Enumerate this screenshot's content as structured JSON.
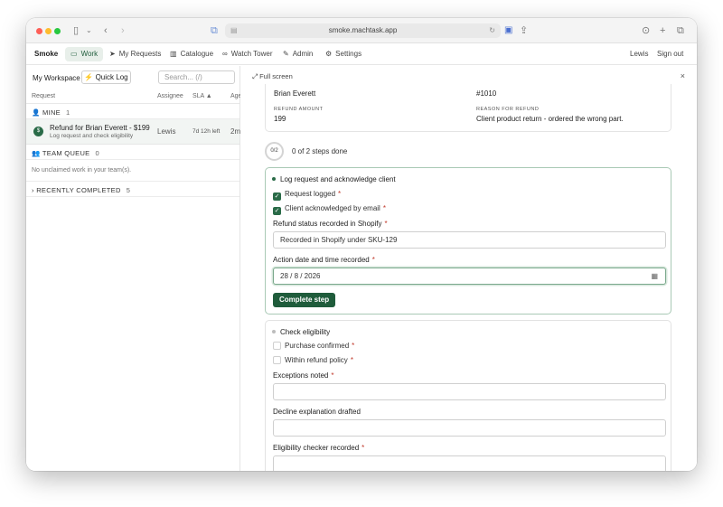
{
  "browser": {
    "url": "smoke.machtask.app"
  },
  "nav": {
    "brand": "Smoke",
    "items": [
      {
        "label": "Work",
        "icon": "inbox-icon",
        "active": true
      },
      {
        "label": "My Requests",
        "icon": "send-icon"
      },
      {
        "label": "Catalogue",
        "icon": "catalogue-icon"
      },
      {
        "label": "Watch Tower",
        "icon": "binoculars-icon"
      },
      {
        "label": "Admin",
        "icon": "wrench-icon"
      },
      {
        "label": "Settings",
        "icon": "gear-icon"
      }
    ],
    "user": "Lewis",
    "sign_out": "Sign out"
  },
  "left": {
    "workspace": "My Workspace",
    "quick_log": "Quick Log",
    "search_placeholder": "Search... (/)",
    "columns": {
      "request": "Request",
      "assignee": "Assignee",
      "sla": "SLA ▲",
      "age": "Age"
    },
    "mine": {
      "label": "MINE",
      "count": "1"
    },
    "row": {
      "title": "Refund for Brian Everett - $199",
      "subtitle": "Log request and check eligibility",
      "assignee": "Lewis",
      "sla": "7d 12h left",
      "age": "2m"
    },
    "team_queue": {
      "label": "TEAM QUEUE",
      "count": "0"
    },
    "empty_text": "No unclaimed work in your team(s).",
    "recently_completed": {
      "label": "RECENTLY COMPLETED",
      "count": "5"
    }
  },
  "right": {
    "full_screen": "Full screen",
    "summary": {
      "client_value": "Brian Everett",
      "order_value": "#1010",
      "refund_label": "REFUND AMOUNT",
      "refund_value": "199",
      "reason_label": "REASON FOR REFUND",
      "reason_value": "Client product return - ordered the wrong part."
    },
    "progress": {
      "ring": "0/2",
      "text": "0 of 2 steps done",
      "fraction": 0
    },
    "step1": {
      "title": "Log request and acknowledge client",
      "check1": "Request logged",
      "check2": "Client acknowledged by email",
      "field1_label": "Refund status recorded in Shopify",
      "field1_value": "Recorded in Shopify under SKU-129",
      "field2_label": "Action date and time recorded",
      "field2_value": "28 / 8 / 2026",
      "button": "Complete step"
    },
    "step2": {
      "title": "Check eligibility",
      "check1": "Purchase confirmed",
      "check2": "Within refund policy",
      "field1_label": "Exceptions noted",
      "field2_label": "Decline explanation drafted",
      "field3_label": "Eligibility checker recorded"
    }
  },
  "colors": {
    "accent": "#1f5c3b",
    "required": "#c0392b"
  }
}
